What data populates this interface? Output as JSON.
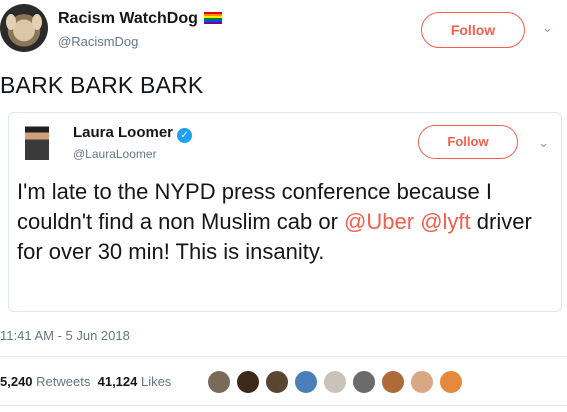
{
  "tweet": {
    "author_name": "Racism WatchDog",
    "author_handle": "@RacismDog",
    "follow_label": "Follow",
    "text": "BARK BARK BARK",
    "timestamp": "11:41 AM - 5 Jun 2018",
    "retweets_count": "5,240",
    "retweets_label": "Retweets",
    "likes_count": "41,124",
    "likes_label": "Likes"
  },
  "quoted_tweet": {
    "author_name": "Laura Loomer",
    "author_handle": "@LauraLoomer",
    "follow_label": "Follow",
    "text_part1": "I'm late to the NYPD press conference because I couldn't find a non Muslim cab or ",
    "mention_1": "@Uber",
    "mention_2": "@lyft",
    "text_part2": " driver for over 30 min! This is insanity."
  },
  "likers": [
    {
      "name": "liker-1",
      "color": "#7a6a5a"
    },
    {
      "name": "liker-2",
      "color": "#3b2a1a"
    },
    {
      "name": "liker-3",
      "color": "#5a4630"
    },
    {
      "name": "liker-4",
      "color": "#4a7fb8"
    },
    {
      "name": "liker-5",
      "color": "#c9c3bb"
    },
    {
      "name": "liker-6",
      "color": "#6b6b6b"
    },
    {
      "name": "liker-7",
      "color": "#b06a3a"
    },
    {
      "name": "liker-8",
      "color": "#d9a784"
    },
    {
      "name": "liker-9",
      "color": "#e58a3c"
    }
  ],
  "colors": {
    "accent": "#f25f4c",
    "verified": "#1da1f2",
    "muted": "#657786"
  },
  "icons": {
    "verified": "verified-icon",
    "chevron": "chevron-down-icon",
    "flag": "rainbow-flag-icon"
  }
}
